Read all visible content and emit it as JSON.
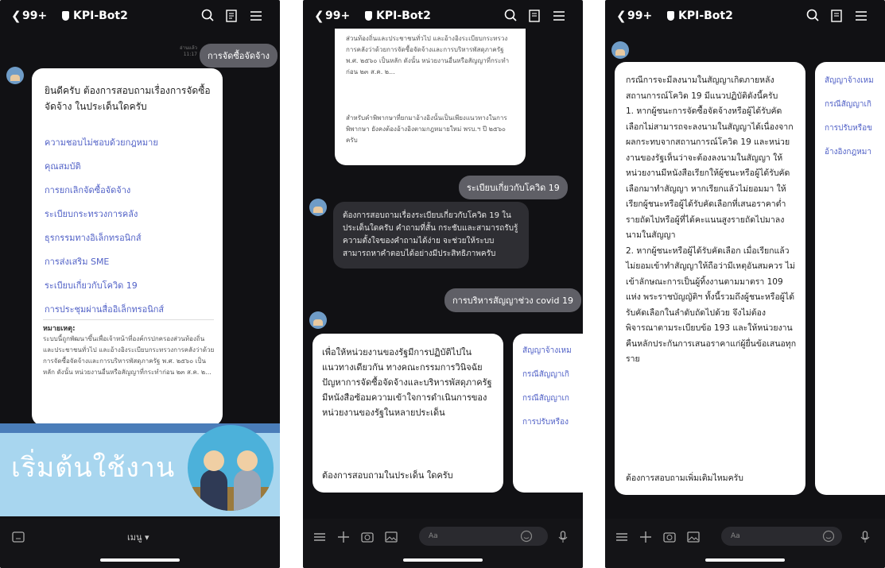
{
  "header": {
    "back_icon": "chevron-left-icon",
    "unread": "99+",
    "title": "KPI-Bot2"
  },
  "p1": {
    "out_msg": "การจัดซื้อจัดจ้าง",
    "ts": "อ่านแล้ว\n11:17",
    "greeting": "ยินดีครับ ต้องการสอบถามเรื่องการจัดซื้อจัดจ้าง ในประเด็นใดครับ",
    "links": [
      "ความชอบไม่ชอบด้วยกฎหมาย",
      "คุณสมบัติ",
      "การยกเลิกจัดซื้อจัดจ้าง",
      "ระเบียบกระทรวงการคลัง",
      "ธุรกรรมทางอิเล็กทรอนิกส์",
      "การส่งเสริม SME",
      "ระเบียบเกี่ยวกับโควิด 19",
      "การประชุมผ่านสื่ออิเล็กทรอนิกส์"
    ],
    "note_title": "หมายเหตุ:",
    "note": "ระบบนี้ถูกพัฒนาขึ้นเพื่อเจ้าหน้าที่องค์กรปกครองส่วนท้องถิ่นและประชาชนทั่วไป และอ้างอิงระเบียบกระทรวงการคลังว่าด้วยการจัดซื้อจัดจ้างและการบริหารพัสดุภาครัฐ พ.ศ. ๒๕๖๐ เป็นหลัก ดังนั้น หน่วยงานอื่นหรือสัญญาที่กระทำก่อน ๒๓ ส.ค. ๒...",
    "banner": "เริ่มต้นใช้งาน",
    "menu": "เมนู ▾"
  },
  "p2": {
    "top_card": "ส่วนท้องถิ่นและประชาชนทั่วไป และอ้างอิงระเบียบกระทรวงการคลังว่าด้วยการจัดซื้อจัดจ้างและการบริหารพัสดุภาครัฐ พ.ศ. ๒๕๖๐ เป็นหลัก ดังนั้น หน่วยงานอื่นหรือสัญญาที่กระทำก่อน ๒๓ ส.ค. ๒...",
    "top_card2": "สำหรับคำพิพากษาที่ยกมาอ้างอิงนั้นเป็นเพียงแนวทางในการพิพากษา ยังคงต้องอ้างอิงตามกฎหมายใหม่ พรบ.ฯ ปี ๒๕๖๐ ครับ",
    "out1": "ระเบียบเกี่ยวกับโควิด 19",
    "bot1": "ต้องการสอบถามเรื่องระเบียบเกี่ยวกับโควิด 19 ในประเด็นใดครับ คำถามที่สั้น กระชับและสามารถรับรู้ความตั้งใจของคำถามได้ง่าย จะช่วยให้ระบบสามารถหาคำตอบได้อย่างมีประสิทธิภาพครับ",
    "out2": "การบริหารสัญญาช่วง covid 19",
    "card_main": "เพื่อให้หน่วยงานของรัฐมีการปฏิบัติไปในแนวทางเดียวกัน ทางคณะกรรมการวินิจฉัยปัญหาการจัดซื้อจัดจ้างและบริหารพัสดุภาครัฐ มีหนังสือซ้อมความเข้าใจการดำเนินการของหน่วยงานของรัฐในหลายประเด็น",
    "card_ask": "ต้องการสอบถามในประเด็น ใดครับ",
    "side_links": [
      "สัญญาจ้างเหม",
      "กรณีสัญญาเกิ",
      "กรณีสัญญาเก",
      "การปรับหรือง"
    ],
    "input_placeholder": "Aa"
  },
  "p3": {
    "card_text": "กรณีการจะมีลงนามในสัญญาเกิดภายหลังสถานการณ์โควิด 19 มีแนวปฏิบัติดังนี้ครับ\n 1. หากผู้ชนะการจัดซื้อจัดจ้างหรือผู้ได้รับคัดเลือกไม่สามารถจะลงนามในสัญญาได้เนื่องจากผลกระทบจากสถานการณ์โควิด 19 และหน่วยงานของรัฐเห็นว่าจะต้องลงนามในสัญญา ให้หน่วยงานมีหนังสือเรียกให้ผู้ชนะหรือผู้ได้รับคัดเลือกมาทำสัญญา หากเรียกแล้วไม่ยอมมา ให้เรียกผู้ชนะหรือผู้ได้รับคัดเลือกที่เสนอราคาต่ำรายถัดไปหรือผู้ที่ได้คะแนนสูงรายถัดไปมาลงนามในสัญญา\n 2. หากผู้ชนะหรือผู้ได้รับคัดเลือก เมื่อเรียกแล้วไม่ยอมเข้าทำสัญญาให้ถือว่ามีเหตุอันสมควร ไม่เข้าลักษณะการเป็นผู้ทิ้งงานตามมาตรา 109 แห่ง พระราชบัญญัติฯ ทั้งนี้รวมถึงผู้ชนะหรือผู้ได้รับคัดเลือกในลำดับถัดไปด้วย จึงไม่ต้องพิจารณาตามระเบียบข้อ 193 และให้หน่วยงานคืนหลักประกันการเสนอราคาแก่ผู้ยื่นข้อเสนอทุกราย",
    "card_ask": "ต้องการสอบถามเพิ่มเติมไหมครับ",
    "side_links": [
      "สัญญาจ้างเหม",
      "กรณีสัญญาเกิ",
      "การปรับหรือข",
      "อ้างอิงกฎหมา"
    ],
    "input_placeholder": "Aa"
  }
}
